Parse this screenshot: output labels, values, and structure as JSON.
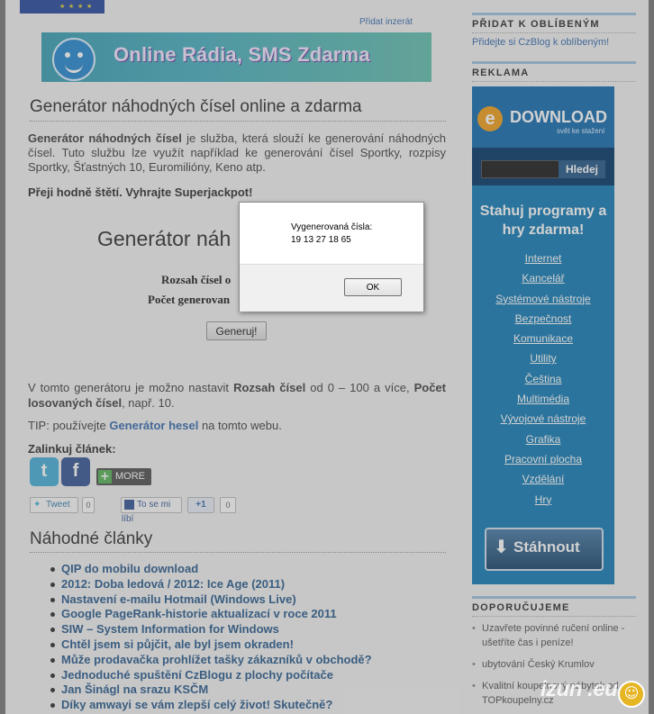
{
  "header": {
    "add_link": "Přidat inzerát",
    "banner_text": "Online Rádia, SMS Zdarma"
  },
  "main": {
    "title": "Generátor náhodných čísel online a zdarma",
    "intro_bold": "Generátor náhodných čísel",
    "intro_rest": " je služba, která slouží ke generování náhodných čísel. Tuto službu lze využít například ke generování čísel Sportky, rozpisy Sportky, Šťastných 10, Euromilióny, Keno atp.",
    "luck": "Přeji hodně štětí. Vyhrajte Superjackpot!",
    "generator_heading": "Generátor náh",
    "range_label": "Rozsah čísel o",
    "count_label": "Počet generovan",
    "generate_button": "Generuj!",
    "desc_1": "V tomto generátoru je možno nastavit ",
    "desc_b1": "Rozsah čísel",
    "desc_2": " od 0 – 100 a více, ",
    "desc_b2": "Počet losovaných čísel",
    "desc_3": ", např. 10.",
    "tip_prefix": "TIP: používejte ",
    "tip_link": "Generátor hesel",
    "tip_suffix": " na tomto webu.",
    "link_label": "Zalinkuj článek:",
    "share_twitter": "t",
    "share_facebook": "f",
    "more_plus": "+",
    "more_label": "MORE",
    "tweet": "Tweet",
    "tweet_count": "0",
    "fb_like": "To se mi líbí",
    "gplus": "+1",
    "gplus_count": "0",
    "random_title": "Náhodné články",
    "articles": [
      "QIP do mobilu download",
      "2012: Doba ledová / 2012: Ice Age (2011)",
      "Nastavení e-mailu Hotmail (Windows Live)",
      "Google PageRank-historie aktualizací v roce 2011",
      "SIW – System Information for Windows",
      "Chtěl jsem si půjčit, ale byl jsem okraden!",
      "Může prodavačka prohlížet tašky zákazníků v obchodě?",
      "Jednoduché spuštění CzBlogu z plochy počítače",
      "Jan Šinágl na srazu KSČM",
      "Díky amwayi se vám zlepší celý život! Skutečně?"
    ]
  },
  "sidebar": {
    "fav_heading": "Přidat k oblíbeným",
    "fav_link": "Přidejte si CzBlog k oblíbeným!",
    "ad_heading": "Reklama",
    "ad": {
      "logo_letter": "e",
      "brand": "DOWNLOAD",
      "brand_sub": "svět ke stažení",
      "search_button": "Hledej",
      "slogan": "Stahuj programy a hry zdarma!",
      "categories": [
        "Internet",
        "Kancelář",
        "Systémové nástroje",
        "Bezpečnost",
        "Komunikace",
        "Utility",
        "Čeština",
        "Multimédia",
        "Vývojové nástroje",
        "Grafika",
        "Pracovní plocha",
        "Vzdělání",
        "Hry"
      ],
      "download_button": "Stáhnout"
    },
    "rec_heading": "Doporučujeme",
    "recommendations": [
      "Uzavřete povinné ručení online - ušetříte čas i peníze!",
      "ubytování Český Krumlov",
      "Kvalitní koupelnový nábytek od TOPkoupelny.cz"
    ]
  },
  "dialog": {
    "message": "Vygenerovaná čísla:",
    "numbers": "19 13 27 18 65",
    "ok": "OK"
  },
  "watermark": {
    "text": "izun .eu"
  }
}
